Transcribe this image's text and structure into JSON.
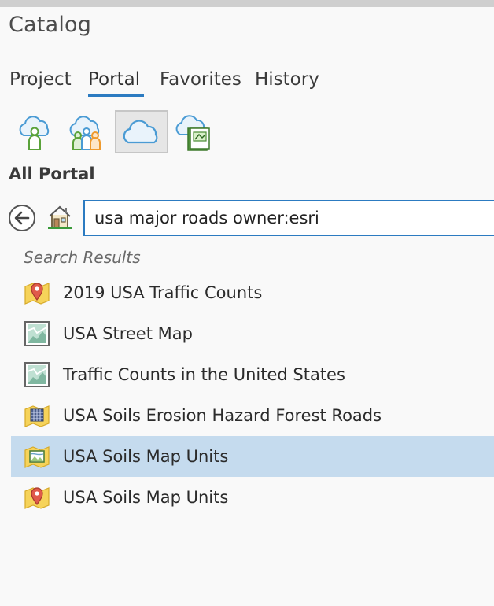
{
  "panel": {
    "title": "Catalog"
  },
  "tabs": [
    {
      "label": "Project",
      "active": false
    },
    {
      "label": "Portal",
      "active": true
    },
    {
      "label": "Favorites",
      "active": false
    },
    {
      "label": "History",
      "active": false
    }
  ],
  "portal_toolbar": {
    "buttons": [
      {
        "icon": "my-content-icon",
        "selected": false
      },
      {
        "icon": "groups-icon",
        "selected": false
      },
      {
        "icon": "all-portal-icon",
        "selected": true
      },
      {
        "icon": "living-atlas-icon",
        "selected": false
      }
    ]
  },
  "section": {
    "title": "All Portal"
  },
  "search": {
    "value": "usa major roads owner:esri"
  },
  "results": {
    "label": "Search Results",
    "items": [
      {
        "label": "2019 USA Traffic Counts",
        "icon": "feature-layer-point-icon",
        "selected": false
      },
      {
        "label": "USA Street Map",
        "icon": "web-map-icon",
        "selected": false
      },
      {
        "label": "Traffic Counts in the United States",
        "icon": "web-map-icon",
        "selected": false
      },
      {
        "label": "USA Soils Erosion Hazard Forest Roads",
        "icon": "tile-layer-icon",
        "selected": false
      },
      {
        "label": "USA Soils Map Units",
        "icon": "imagery-layer-icon",
        "selected": true
      },
      {
        "label": "USA Soils Map Units",
        "icon": "feature-layer-point-icon",
        "selected": false
      }
    ]
  },
  "colors": {
    "accent": "#2c7bc1",
    "selection": "#c5dbee",
    "cloud": "#5aa6d8",
    "person_green": "#6ab34a",
    "person_orange": "#f0a23a"
  }
}
